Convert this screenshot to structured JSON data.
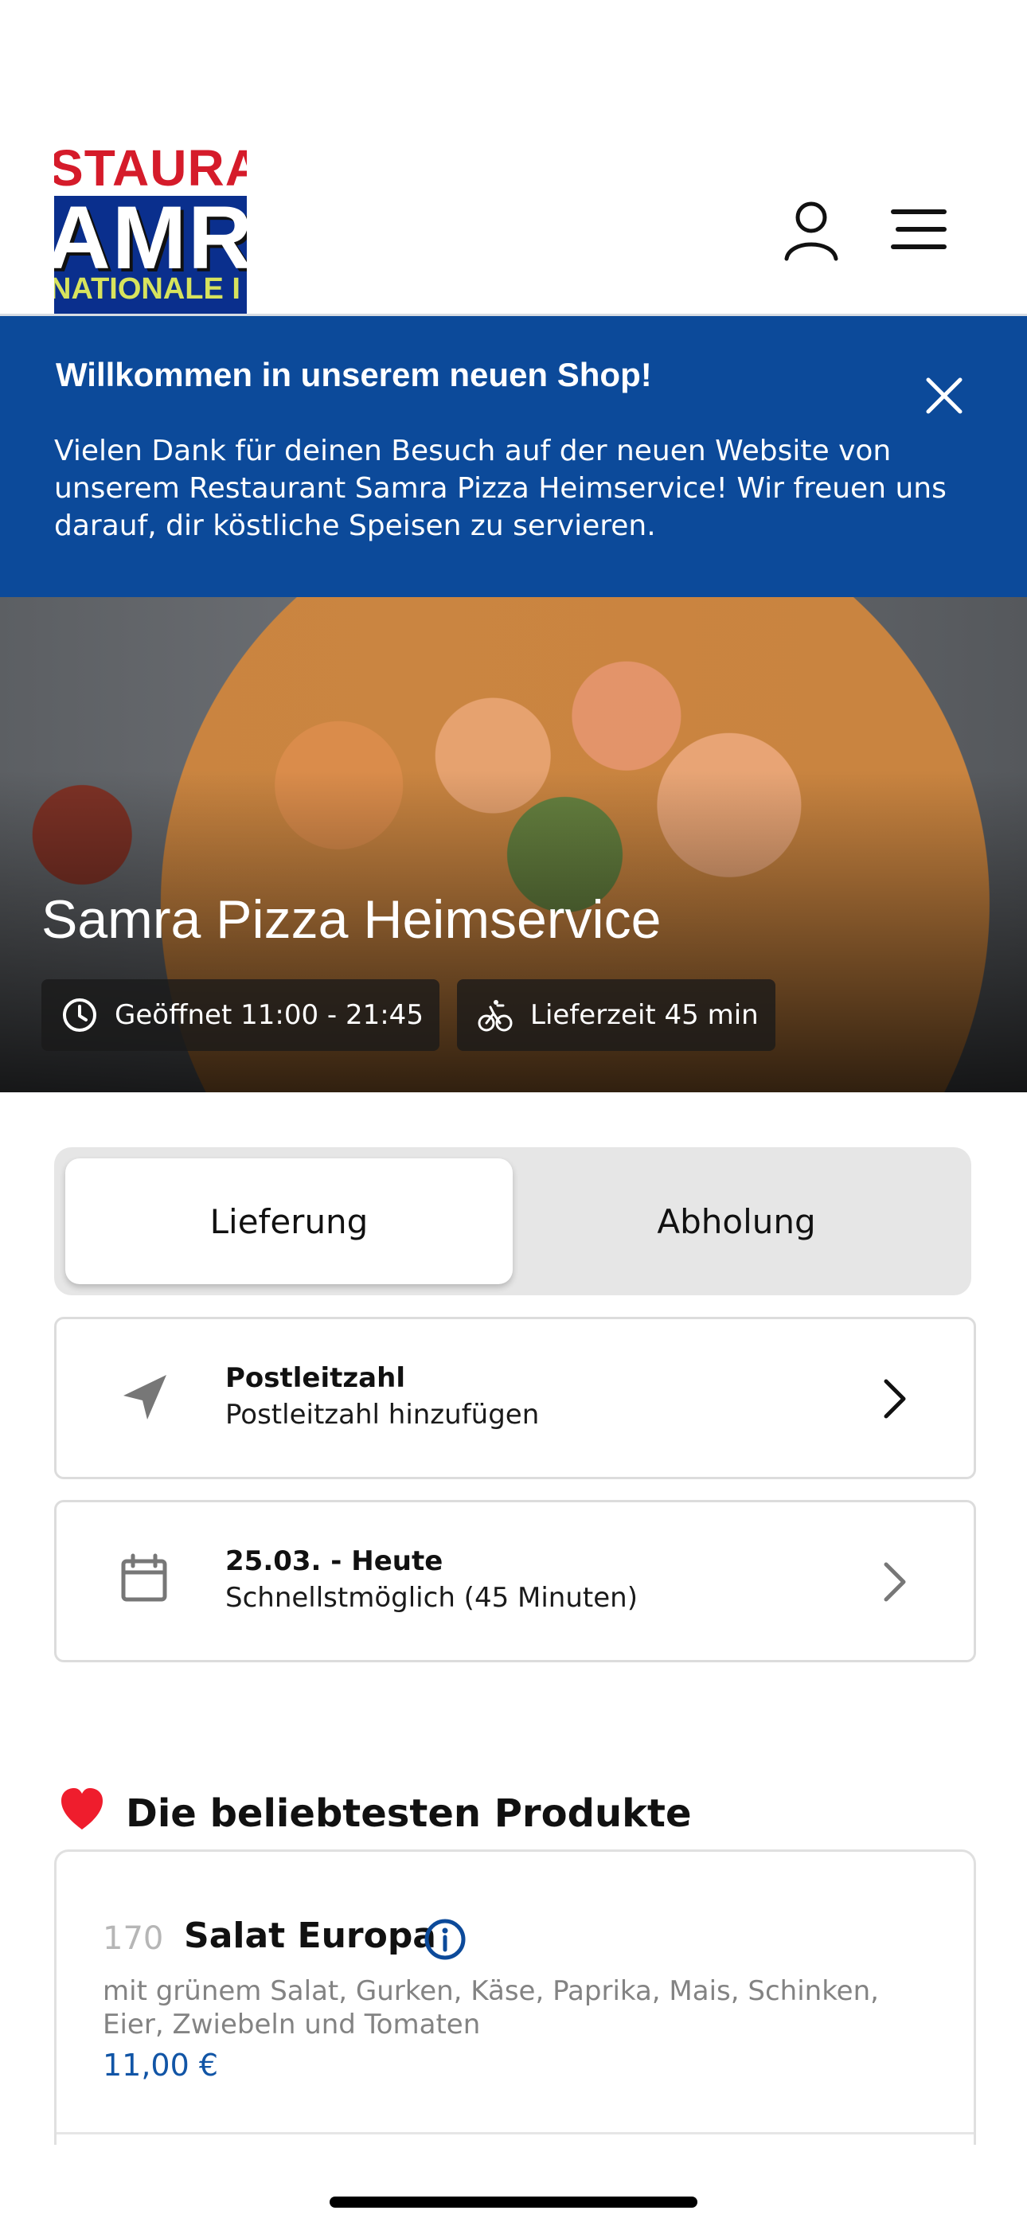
{
  "header": {
    "logo": {
      "top_text": "STAURAN",
      "mid_text": "AMR",
      "bottom_text": "NATIONALE I"
    },
    "icons": {
      "user": "user-icon",
      "menu": "menu-icon"
    }
  },
  "banner": {
    "title": "Willkommen in unserem neuen Shop!",
    "text": "Vielen Dank für deinen Besuch auf der neuen Website von unserem Restaurant Samra Pizza Heimservice! Wir freuen uns darauf, dir köstliche Speisen zu servieren.",
    "close_icon": "close-icon",
    "background_color": "#0c4a9a"
  },
  "hero": {
    "title": "Samra Pizza Heimservice",
    "opening_hours": "Geöffnet 11:00 - 21:45",
    "delivery_time": "Lieferzeit 45 min",
    "icons": {
      "clock": "clock-icon",
      "bike": "bike-icon"
    }
  },
  "mode_toggle": {
    "delivery": "Lieferung",
    "pickup": "Abholung",
    "selected": "Lieferung"
  },
  "postal_code": {
    "title": "Postleitzahl",
    "value": "Postleitzahl hinzufügen",
    "icon": "location-arrow-icon"
  },
  "delivery_date": {
    "title": "25.03. - Heute",
    "value": "Schnellstmöglich (45 Minuten)",
    "icon": "calendar-icon"
  },
  "popular_products": {
    "heart": "❤️",
    "title": "Die beliebtesten Produkte",
    "items": [
      {
        "number": "170",
        "name": "Salat Europa",
        "description": "mit grünem Salat, Gurken, Käse, Paprika, Mais, Schinken, Eier, Zwiebeln und Tomaten",
        "price": "11,00 €",
        "info_icon": "info-icon"
      }
    ]
  },
  "colors": {
    "brand_blue": "#0c4a9a",
    "price_blue": "#1155a6",
    "toggle_gray": "#e6e6e6"
  }
}
